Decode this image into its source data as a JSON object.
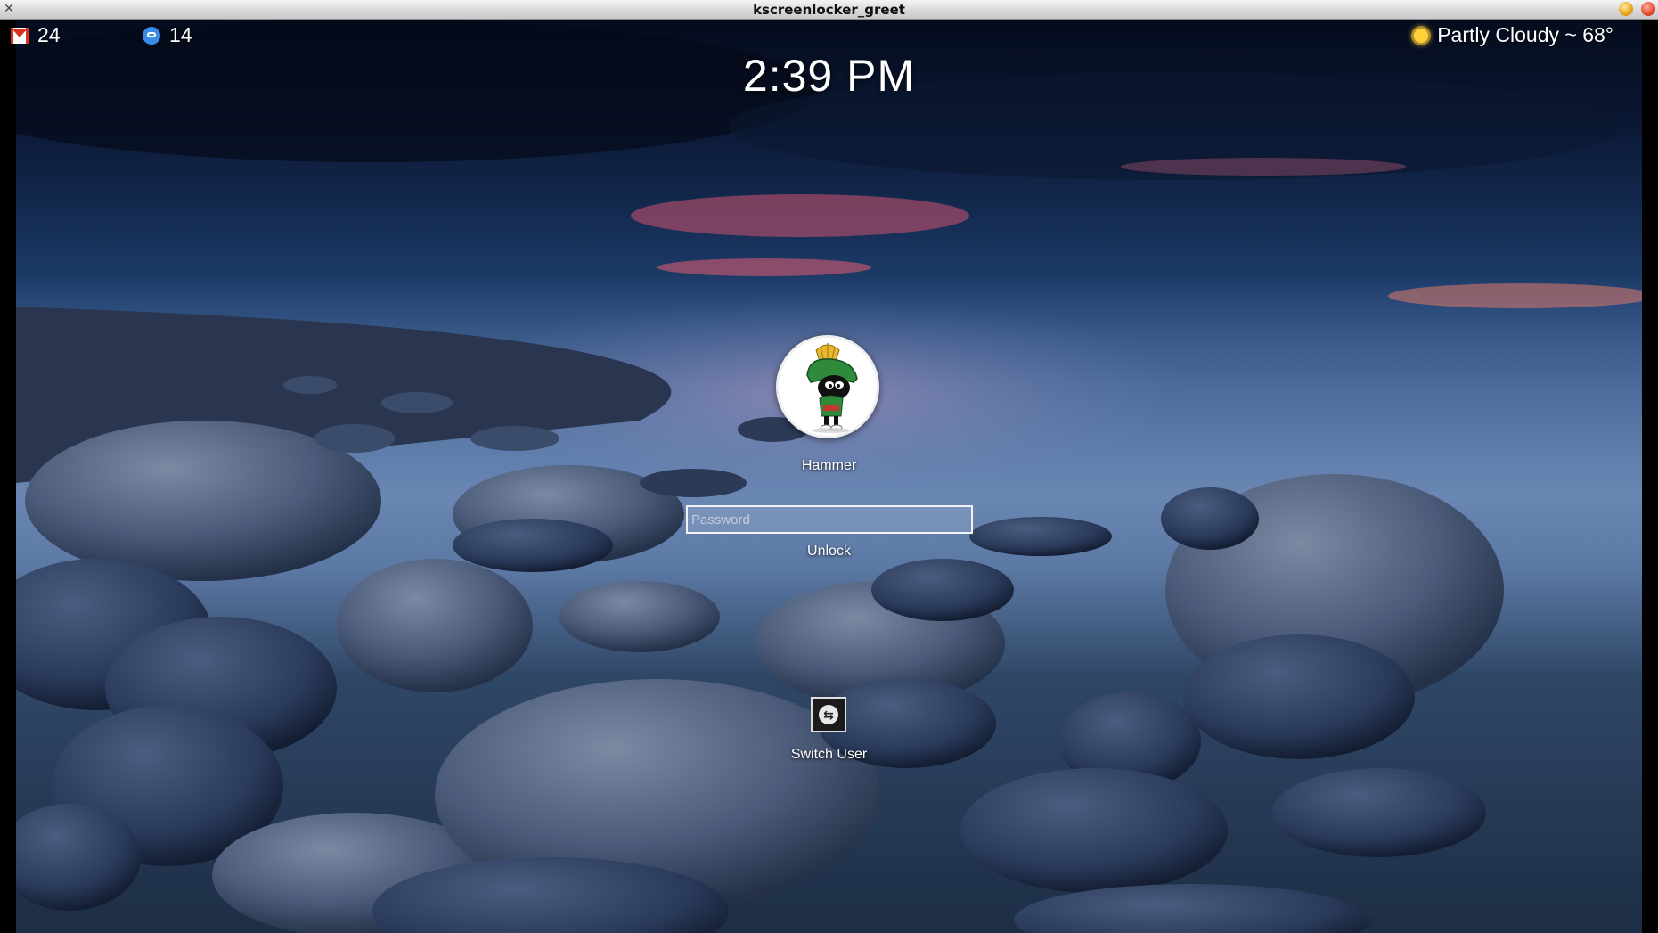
{
  "window": {
    "title": "kscreenlocker_greet"
  },
  "widgets": {
    "mail": {
      "icon": "gmail-icon",
      "count": "24",
      "color": "#d93025"
    },
    "chat": {
      "icon": "chat-bubble-icon",
      "count": "14",
      "color": "#3c8ce7"
    },
    "weather": {
      "icon": "sun-icon",
      "text": "Partly Cloudy ~ 68°"
    }
  },
  "clock": {
    "time": "2:39 PM"
  },
  "login": {
    "avatar": "marvin-martian-avatar",
    "username": "Hammer",
    "password_placeholder": "Password",
    "unlock_label": "Unlock"
  },
  "actions": {
    "switch_user_label": "Switch User",
    "switch_user_icon": "switch-user-icon"
  }
}
